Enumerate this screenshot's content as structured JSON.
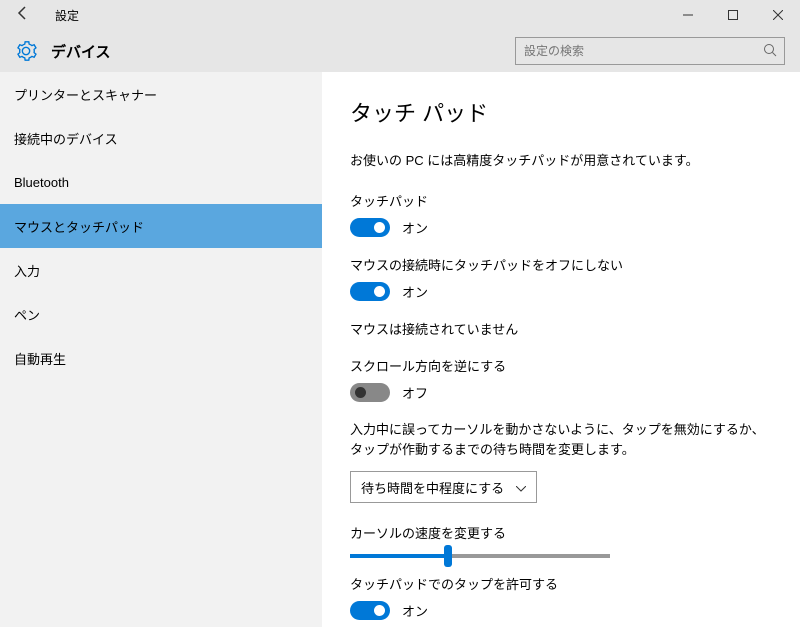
{
  "titlebar": {
    "title": "設定"
  },
  "header": {
    "title": "デバイス",
    "search_placeholder": "設定の検索"
  },
  "sidebar": {
    "items": [
      {
        "label": "プリンターとスキャナー"
      },
      {
        "label": "接続中のデバイス"
      },
      {
        "label": "Bluetooth"
      },
      {
        "label": "マウスとタッチパッド"
      },
      {
        "label": "入力"
      },
      {
        "label": "ペン"
      },
      {
        "label": "自動再生"
      }
    ],
    "selected": 3
  },
  "content": {
    "page_title": "タッチ パッド",
    "intro": "お使いの PC には高精度タッチパッドが用意されています。",
    "touchpad_label": "タッチパッド",
    "touchpad_state": "オン",
    "mouse_off_label": "マウスの接続時にタッチパッドをオフにしない",
    "mouse_off_state": "オン",
    "mouse_status": "マウスは接続されていません",
    "scroll_reverse_label": "スクロール方向を逆にする",
    "scroll_reverse_state": "オフ",
    "delay_para": "入力中に誤ってカーソルを動かさないように、タップを無効にするか、タップが作動するまでの待ち時間を変更します。",
    "delay_dropdown": "待ち時間を中程度にする",
    "cursor_speed_label": "カーソルの速度を変更する",
    "tap_allow_label": "タッチパッドでのタップを許可する",
    "tap_allow_state": "オン"
  }
}
